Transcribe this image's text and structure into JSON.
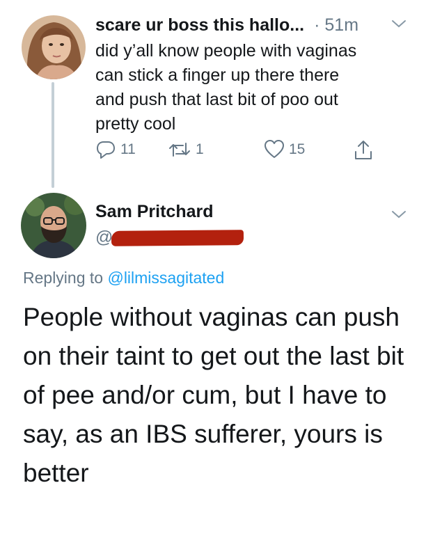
{
  "tweet1": {
    "author_name": "scare ur boss this hallo...",
    "time": "· 51m",
    "text_lines": [
      "did y’all know people with vaginas",
      "can stick a finger up there there",
      "and push that last bit of poo out",
      "pretty cool"
    ],
    "actions": {
      "reply_count": "11",
      "retweet_count": "1",
      "like_count": "15"
    }
  },
  "tweet2": {
    "author_name": "Sam Pritchard",
    "handle_prefix": "@",
    "replying_prefix": "Replying to ",
    "replying_handle": "@lilmissagitated",
    "text_lines": [
      "People without vaginas can push",
      "on their taint to get out the last bit",
      "of pee and/or cum, but I have to",
      "say, as an IBS sufferer, yours is",
      "better"
    ]
  },
  "icons": {
    "menu": "chevron-down-icon",
    "reply": "reply-icon",
    "retweet": "retweet-icon",
    "like": "heart-icon",
    "share": "share-icon"
  },
  "colors": {
    "link": "#1da1f2",
    "secondary_text": "#657786",
    "thread_line": "#c4cfd6",
    "redaction": "#b3210e"
  }
}
